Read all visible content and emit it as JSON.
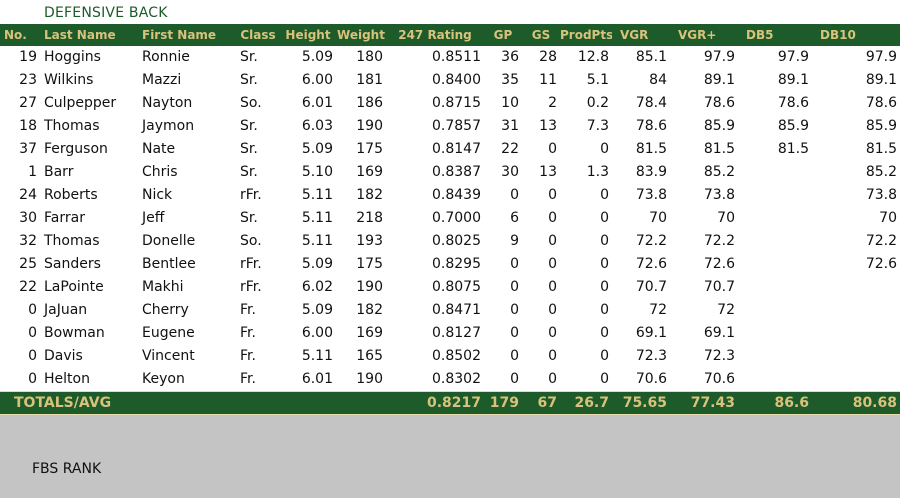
{
  "title": "DEFENSIVE BACK",
  "columns": [
    "No.",
    "Last Name",
    "First Name",
    "Class",
    "Height",
    "Weight",
    "247 Rating",
    "GP",
    "GS",
    "ProdPts",
    "VGR",
    "VGR+",
    "DB5",
    "DB10"
  ],
  "rows": [
    [
      "19",
      "Hoggins",
      "Ronnie",
      "Sr.",
      "5.09",
      "180",
      "0.8511",
      "36",
      "28",
      "12.8",
      "85.1",
      "97.9",
      "97.9",
      "97.9"
    ],
    [
      "23",
      "Wilkins",
      "Mazzi",
      "Sr.",
      "6.00",
      "181",
      "0.8400",
      "35",
      "11",
      "5.1",
      "84",
      "89.1",
      "89.1",
      "89.1"
    ],
    [
      "27",
      "Culpepper",
      "Nayton",
      "So.",
      "6.01",
      "186",
      "0.8715",
      "10",
      "2",
      "0.2",
      "78.4",
      "78.6",
      "78.6",
      "78.6"
    ],
    [
      "18",
      "Thomas",
      "Jaymon",
      "Sr.",
      "6.03",
      "190",
      "0.7857",
      "31",
      "13",
      "7.3",
      "78.6",
      "85.9",
      "85.9",
      "85.9"
    ],
    [
      "37",
      "Ferguson",
      "Nate",
      "Sr.",
      "5.09",
      "175",
      "0.8147",
      "22",
      "0",
      "0",
      "81.5",
      "81.5",
      "81.5",
      "81.5"
    ],
    [
      "1",
      "Barr",
      "Chris",
      "Sr.",
      "5.10",
      "169",
      "0.8387",
      "30",
      "13",
      "1.3",
      "83.9",
      "85.2",
      "",
      "85.2"
    ],
    [
      "24",
      "Roberts",
      "Nick",
      "rFr.",
      "5.11",
      "182",
      "0.8439",
      "0",
      "0",
      "0",
      "73.8",
      "73.8",
      "",
      "73.8"
    ],
    [
      "30",
      "Farrar",
      "Jeff",
      "Sr.",
      "5.11",
      "218",
      "0.7000",
      "6",
      "0",
      "0",
      "70",
      "70",
      "",
      "70"
    ],
    [
      "32",
      "Thomas",
      "Donelle",
      "So.",
      "5.11",
      "193",
      "0.8025",
      "9",
      "0",
      "0",
      "72.2",
      "72.2",
      "",
      "72.2"
    ],
    [
      "25",
      "Sanders",
      "Bentlee",
      "rFr.",
      "5.09",
      "175",
      "0.8295",
      "0",
      "0",
      "0",
      "72.6",
      "72.6",
      "",
      "72.6"
    ],
    [
      "22",
      "LaPointe",
      "Makhi",
      "rFr.",
      "6.02",
      "190",
      "0.8075",
      "0",
      "0",
      "0",
      "70.7",
      "70.7",
      "",
      ""
    ],
    [
      "0",
      "JaJuan",
      "Cherry",
      "Fr.",
      "5.09",
      "182",
      "0.8471",
      "0",
      "0",
      "0",
      "72",
      "72",
      "",
      ""
    ],
    [
      "0",
      "Bowman",
      "Eugene",
      "Fr.",
      "6.00",
      "169",
      "0.8127",
      "0",
      "0",
      "0",
      "69.1",
      "69.1",
      "",
      ""
    ],
    [
      "0",
      "Davis",
      "Vincent",
      "Fr.",
      "5.11",
      "165",
      "0.8502",
      "0",
      "0",
      "0",
      "72.3",
      "72.3",
      "",
      ""
    ],
    [
      "0",
      "Helton",
      "Keyon",
      "Fr.",
      "6.01",
      "190",
      "0.8302",
      "0",
      "0",
      "0",
      "70.6",
      "70.6",
      "",
      ""
    ]
  ],
  "totals": {
    "label": "TOTALS/AVG",
    "rating": "0.8217",
    "gp": "179",
    "gs": "67",
    "prodpts": "26.7",
    "vgr": "75.65",
    "vgr_plus": "77.43",
    "db5": "86.6",
    "db10": "80.68"
  },
  "fbs_rank_label": "FBS RANK",
  "colors": {
    "header_green": "#1d5b2a",
    "header_gold": "#d9c27b",
    "footer_gray": "#c4c4c4"
  }
}
